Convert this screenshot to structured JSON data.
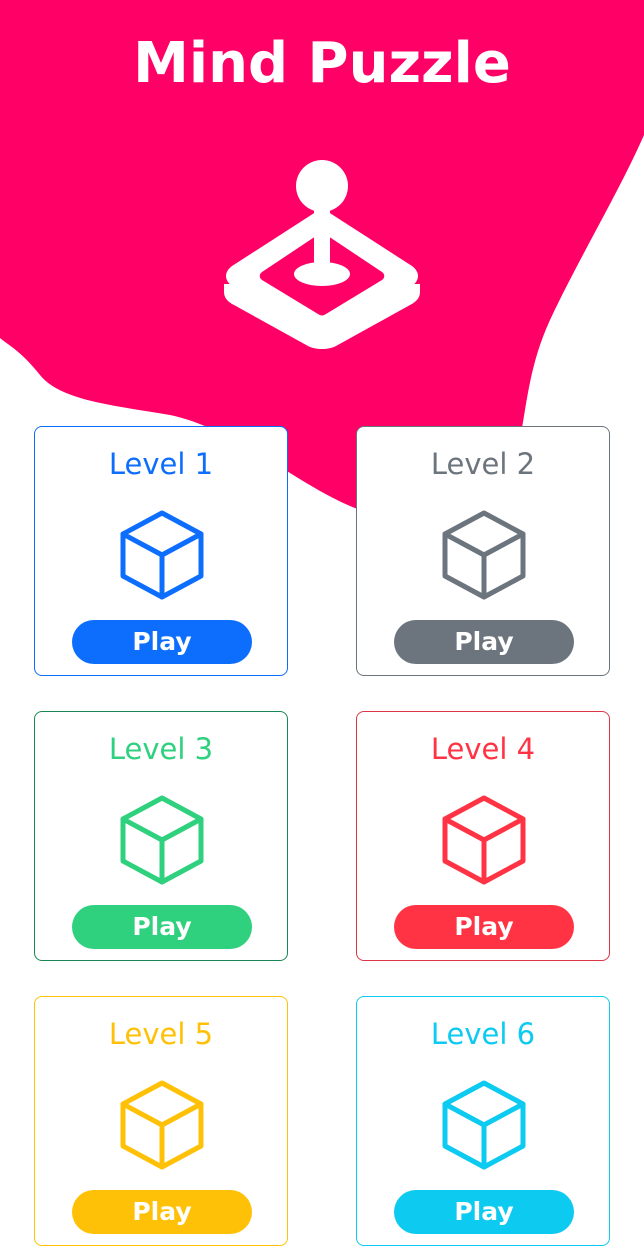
{
  "app": {
    "title": "Mind Puzzle",
    "accent_color": "#ff0066",
    "hero_icon": "joystick-icon"
  },
  "levels": [
    {
      "label": "Level 1",
      "button": "Play",
      "color": "#0d6efd",
      "icon": "box-icon"
    },
    {
      "label": "Level 2",
      "button": "Play",
      "color": "#6c757d",
      "icon": "box-icon"
    },
    {
      "label": "Level 3",
      "button": "Play",
      "color": "#2fd07e",
      "icon": "box-icon",
      "border_color": "#198754"
    },
    {
      "label": "Level 4",
      "button": "Play",
      "color": "#ff3344",
      "icon": "box-icon",
      "border_color": "#dc3545"
    },
    {
      "label": "Level 5",
      "button": "Play",
      "color": "#ffc107",
      "icon": "box-icon"
    },
    {
      "label": "Level 6",
      "button": "Play",
      "color": "#0dcaf0",
      "icon": "box-icon"
    }
  ]
}
